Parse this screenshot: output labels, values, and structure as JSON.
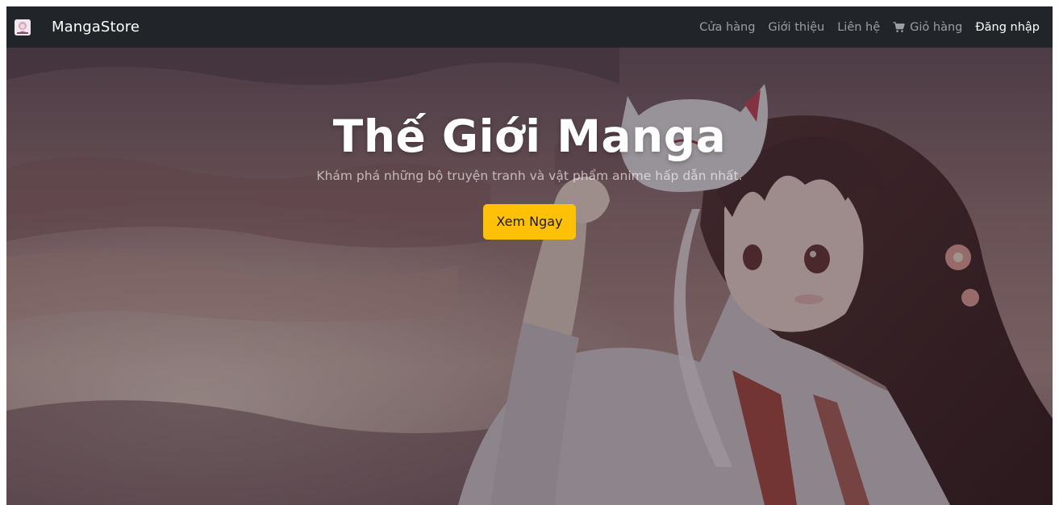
{
  "navbar": {
    "brand": "MangaStore",
    "links": [
      {
        "label": "Cửa hàng"
      },
      {
        "label": "Giới thiệu"
      },
      {
        "label": "Liên hệ"
      },
      {
        "label": "Giỏ hàng",
        "icon": "cart-icon"
      },
      {
        "label": "Đăng nhập",
        "active": true
      }
    ]
  },
  "hero": {
    "title": "Thế Giới Manga",
    "subtitle": "Khám phá những bộ truyện tranh và vật phẩm anime hấp dẫn nhất.",
    "button_label": "Xem Ngay"
  },
  "colors": {
    "navbar_bg": "#212529",
    "accent": "#ffc107",
    "text_light": "#ffffff"
  }
}
